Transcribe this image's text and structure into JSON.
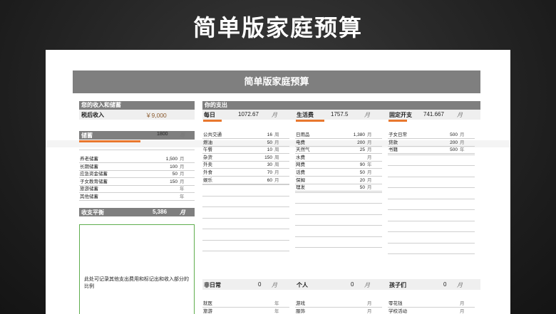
{
  "banner_title": "简单版家庭预算",
  "sheet_title": "简单版家庭预算",
  "income": {
    "header": "您的收入和储蓄",
    "after_tax_label": "税后收入",
    "after_tax_value": "￥9,000"
  },
  "savings": {
    "label": "储蓄",
    "value": "1800",
    "unit": "周",
    "items": [
      {
        "name": "养老储蓄",
        "value": "1,500",
        "unit": "月"
      },
      {
        "name": "长期储蓄",
        "value": "100",
        "unit": "月"
      },
      {
        "name": "应急资金储蓄",
        "value": "50",
        "unit": "月"
      },
      {
        "name": "子女教育储蓄",
        "value": "150",
        "unit": "月"
      },
      {
        "name": "旅游储蓄",
        "value": "",
        "unit": "年"
      },
      {
        "name": "其他储蓄",
        "value": "",
        "unit": "年"
      }
    ]
  },
  "balance": {
    "label": "收支平衡",
    "value": "5,386",
    "unit": "月"
  },
  "note": "此处可记录其他支出费用和标记出和收入部分的比例",
  "expenses_header": "你的支出",
  "daily": {
    "label": "每日",
    "value": "1072.67",
    "unit": "月",
    "items": [
      {
        "name": "公共交通",
        "value": "16",
        "unit": "周"
      },
      {
        "name": "燃油",
        "value": "50",
        "unit": "月"
      },
      {
        "name": "午餐",
        "value": "10",
        "unit": "周"
      },
      {
        "name": "杂货",
        "value": "150",
        "unit": "周"
      },
      {
        "name": "外卖",
        "value": "30",
        "unit": "周"
      },
      {
        "name": "外食",
        "value": "70",
        "unit": "月"
      },
      {
        "name": "娱乐",
        "value": "60",
        "unit": "月"
      }
    ]
  },
  "living": {
    "label": "生活费",
    "value": "1757.5",
    "unit": "月",
    "items": [
      {
        "name": "日用品",
        "value": "1,380",
        "unit": "月"
      },
      {
        "name": "电费",
        "value": "200",
        "unit": "月"
      },
      {
        "name": "天然气",
        "value": "25",
        "unit": "月"
      },
      {
        "name": "水费",
        "value": "",
        "unit": "月"
      },
      {
        "name": "网费",
        "value": "90",
        "unit": "年"
      },
      {
        "name": "话费",
        "value": "50",
        "unit": "月"
      },
      {
        "name": "保姆",
        "value": "20",
        "unit": "月"
      },
      {
        "name": "理发",
        "value": "50",
        "unit": "月"
      }
    ]
  },
  "fixed": {
    "label": "固定开支",
    "value": "741.667",
    "unit": "月",
    "items": [
      {
        "name": "子女日常",
        "value": "500",
        "unit": "月"
      },
      {
        "name": "贷款",
        "value": "200",
        "unit": "月"
      },
      {
        "name": "书籍",
        "value": "500",
        "unit": "年"
      }
    ]
  },
  "irregular": {
    "label": "非日常",
    "value": "0",
    "unit": "月",
    "items": [
      {
        "name": "就医",
        "value": "",
        "unit": "年"
      },
      {
        "name": "旅游",
        "value": "",
        "unit": "年"
      }
    ]
  },
  "personal": {
    "label": "个人",
    "value": "0",
    "unit": "月",
    "items": [
      {
        "name": "游戏",
        "value": "",
        "unit": "月"
      },
      {
        "name": "服饰",
        "value": "",
        "unit": "月"
      }
    ]
  },
  "kids": {
    "label": "孩子们",
    "value": "0",
    "unit": "月",
    "items": [
      {
        "name": "零花钱",
        "value": "",
        "unit": "月"
      },
      {
        "name": "学校活动",
        "value": "",
        "unit": "月"
      }
    ]
  }
}
